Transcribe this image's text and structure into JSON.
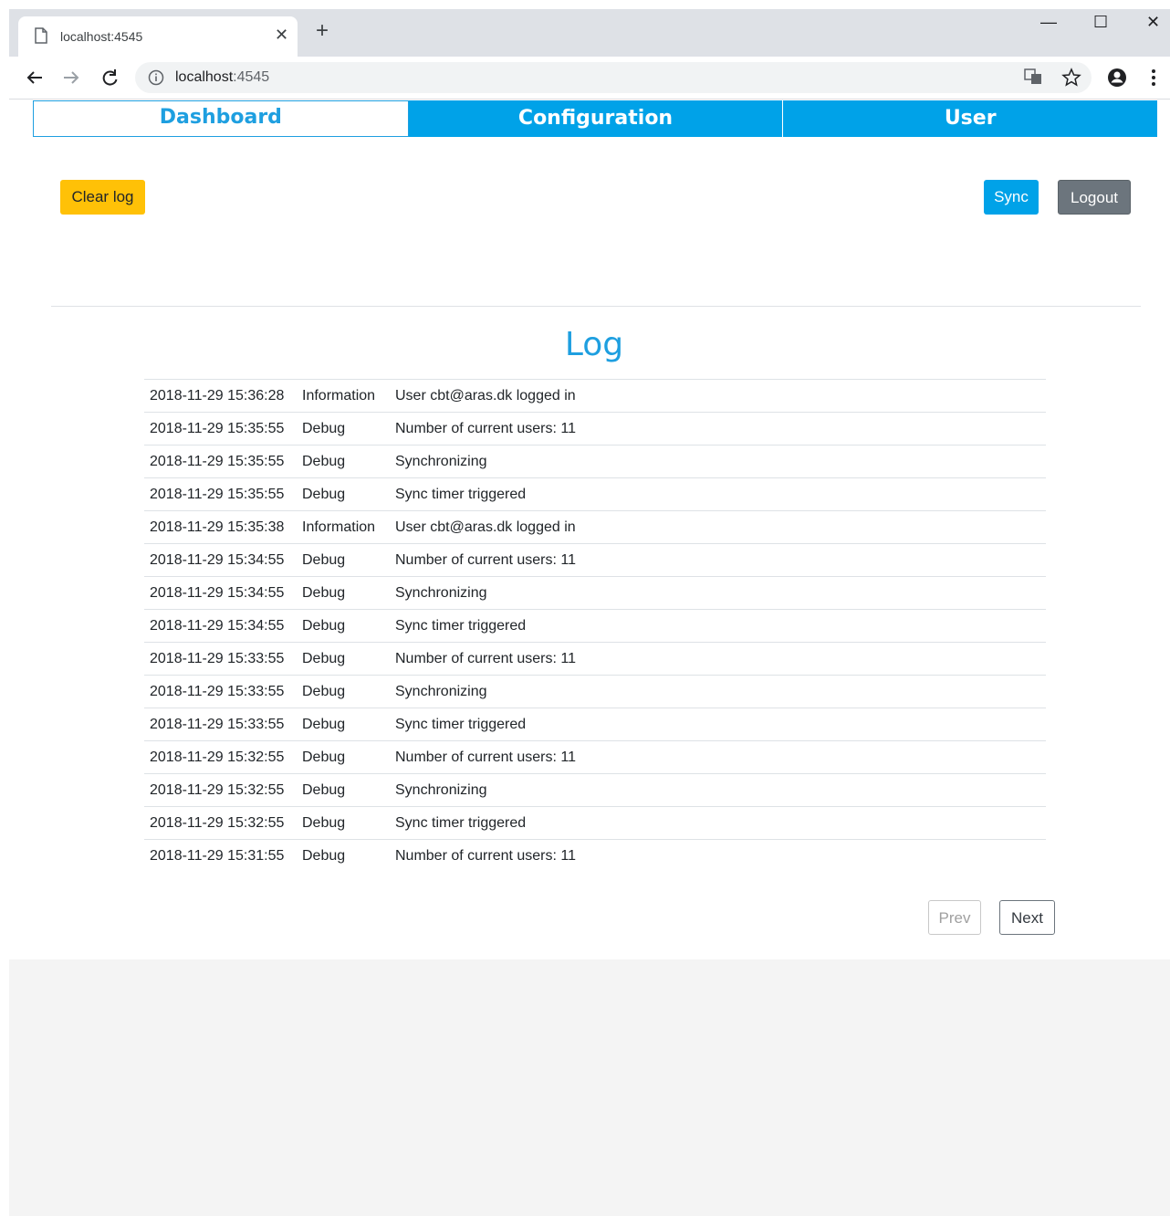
{
  "browser": {
    "tab_title": "localhost:4545",
    "new_tab_label": "+",
    "close_tab_label": "✕",
    "url_host": "localhost",
    "url_port": ":4545",
    "win_min": "—",
    "win_max": "☐",
    "win_close": "✕"
  },
  "nav": {
    "tabs": [
      {
        "label": "Dashboard"
      },
      {
        "label": "Configuration"
      },
      {
        "label": "User"
      }
    ]
  },
  "actions": {
    "clear_log": "Clear log",
    "sync": "Sync",
    "logout": "Logout"
  },
  "log": {
    "heading": "Log",
    "rows": [
      {
        "timestamp": "2018-11-29 15:36:28",
        "level": "Information",
        "message": "User cbt@aras.dk logged in"
      },
      {
        "timestamp": "2018-11-29 15:35:55",
        "level": "Debug",
        "message": "Number of current users: 11"
      },
      {
        "timestamp": "2018-11-29 15:35:55",
        "level": "Debug",
        "message": "Synchronizing"
      },
      {
        "timestamp": "2018-11-29 15:35:55",
        "level": "Debug",
        "message": "Sync timer triggered"
      },
      {
        "timestamp": "2018-11-29 15:35:38",
        "level": "Information",
        "message": "User cbt@aras.dk logged in"
      },
      {
        "timestamp": "2018-11-29 15:34:55",
        "level": "Debug",
        "message": "Number of current users: 11"
      },
      {
        "timestamp": "2018-11-29 15:34:55",
        "level": "Debug",
        "message": "Synchronizing"
      },
      {
        "timestamp": "2018-11-29 15:34:55",
        "level": "Debug",
        "message": "Sync timer triggered"
      },
      {
        "timestamp": "2018-11-29 15:33:55",
        "level": "Debug",
        "message": "Number of current users: 11"
      },
      {
        "timestamp": "2018-11-29 15:33:55",
        "level": "Debug",
        "message": "Synchronizing"
      },
      {
        "timestamp": "2018-11-29 15:33:55",
        "level": "Debug",
        "message": "Sync timer triggered"
      },
      {
        "timestamp": "2018-11-29 15:32:55",
        "level": "Debug",
        "message": "Number of current users: 11"
      },
      {
        "timestamp": "2018-11-29 15:32:55",
        "level": "Debug",
        "message": "Synchronizing"
      },
      {
        "timestamp": "2018-11-29 15:32:55",
        "level": "Debug",
        "message": "Sync timer triggered"
      },
      {
        "timestamp": "2018-11-29 15:31:55",
        "level": "Debug",
        "message": "Number of current users: 11"
      }
    ]
  },
  "pagination": {
    "prev": "Prev",
    "next": "Next"
  },
  "colors": {
    "accent": "#00a2e8",
    "warning": "#ffc107",
    "secondary": "#6c757d"
  }
}
